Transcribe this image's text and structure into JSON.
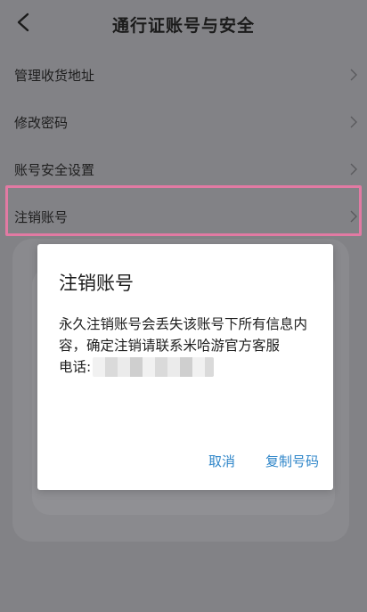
{
  "header": {
    "title": "通行证账号与安全",
    "back_icon": "chevron-left-icon"
  },
  "menu": {
    "items": [
      {
        "label": "管理收货地址"
      },
      {
        "label": "修改密码"
      },
      {
        "label": "账号安全设置"
      },
      {
        "label": "注销账号"
      }
    ],
    "chevron_icon": "chevron-right-icon"
  },
  "dialog": {
    "title": "注销账号",
    "message": "永久注销账号会丢失该账号下所有信息内容，确定注销请联系米哈游官方客服",
    "phone_label": "电话:",
    "cancel_label": "取消",
    "copy_label": "复制号码"
  },
  "colors": {
    "accent": "#2f86c9",
    "highlight": "#e27aa3"
  }
}
